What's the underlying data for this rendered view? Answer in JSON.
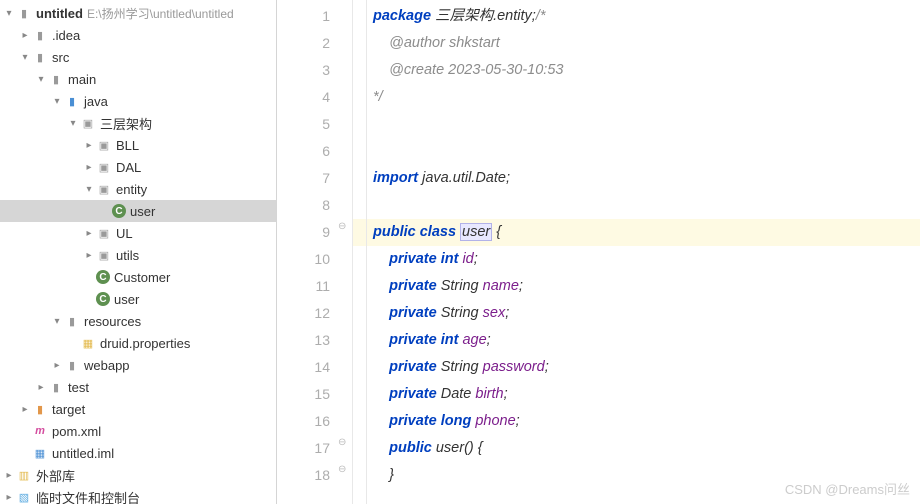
{
  "tree": {
    "root": {
      "name": "untitled",
      "path": "E:\\扬州学习\\untitled\\untitled"
    },
    "idea": ".idea",
    "src": "src",
    "main": "main",
    "java": "java",
    "pkg1": "三层架构",
    "bll": "BLL",
    "dal": "DAL",
    "entity": "entity",
    "user": "user",
    "ul": "UL",
    "utils": "utils",
    "customer": "Customer",
    "user2": "user",
    "resources": "resources",
    "druid": "druid.properties",
    "webapp": "webapp",
    "test": "test",
    "target": "target",
    "pom": "pom.xml",
    "iml": "untitled.iml",
    "ext": "外部库",
    "scratch": "临时文件和控制台"
  },
  "code": {
    "l1a": "package",
    "l1b": " 三层架构.entity;",
    "l1c": "/*",
    "l2": "    @author shkstart",
    "l3": "    @create 2023-05-30-10:53",
    "l4": "*/",
    "l7a": "import",
    "l7b": " java.util.Date;",
    "l9a": "public class ",
    "l9b": "user",
    "l9c": " {",
    "l10a": "private int ",
    "l10b": "id",
    "l10c": ";",
    "l11a": "private ",
    "l11b": "String ",
    "l11c": "name",
    "l11d": ";",
    "l12a": "private ",
    "l12b": "String ",
    "l12c": "sex",
    "l12d": ";",
    "l13a": "private int ",
    "l13b": "age",
    "l13c": ";",
    "l14a": "private ",
    "l14b": "String ",
    "l14c": "password",
    "l14d": ";",
    "l15a": "private ",
    "l15b": "Date ",
    "l15c": "birth",
    "l15d": ";",
    "l16a": "private long ",
    "l16b": "phone",
    "l16c": ";",
    "l17a": "public ",
    "l17b": "user() {",
    "l18": "}"
  },
  "lines": [
    "1",
    "2",
    "3",
    "4",
    "5",
    "6",
    "7",
    "8",
    "9",
    "10",
    "11",
    "12",
    "13",
    "14",
    "15",
    "16",
    "17",
    "18"
  ],
  "watermark": "CSDN @Dreams问丝"
}
